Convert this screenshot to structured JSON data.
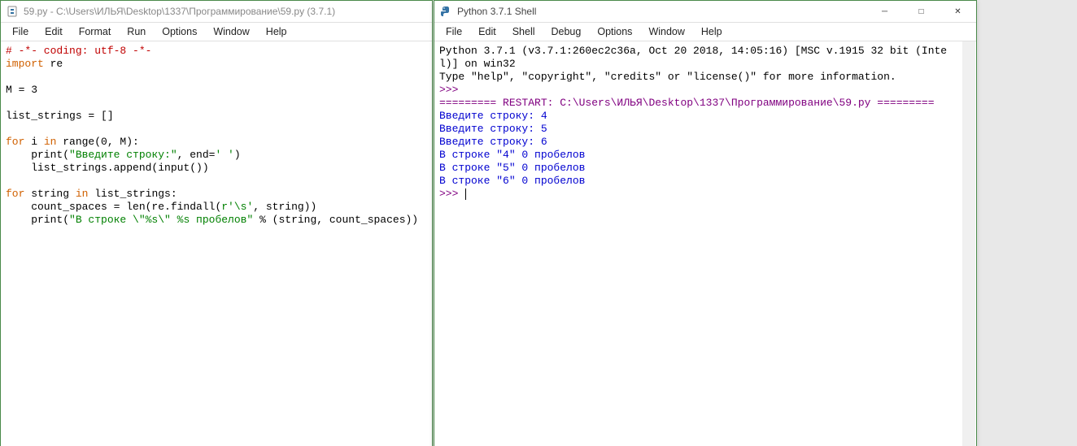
{
  "editor": {
    "title": "59.py - C:\\Users\\ИЛЬЯ\\Desktop\\1337\\Программирование\\59.py (3.7.1)",
    "menu": [
      "File",
      "Edit",
      "Format",
      "Run",
      "Options",
      "Window",
      "Help"
    ],
    "code": {
      "l1": "# -*- coding: utf-8 -*-",
      "l2a": "import",
      "l2b": " re",
      "l3": "",
      "l4": "M = 3",
      "l5": "",
      "l6": "list_strings = []",
      "l7": "",
      "l8a": "for",
      "l8b": " i ",
      "l8c": "in",
      "l8d": " range(0, M):",
      "l9a": "    print(",
      "l9b": "\"Введите строку:\"",
      "l9c": ", end=",
      "l9d": "' '",
      "l9e": ")",
      "l10": "    list_strings.append(input())",
      "l11": "",
      "l12a": "for",
      "l12b": " string ",
      "l12c": "in",
      "l12d": " list_strings:",
      "l13a": "    count_spaces = len(re.findall(",
      "l13b": "r'\\s'",
      "l13c": ", string))",
      "l14a": "    print(",
      "l14b": "\"В строке \\\"%s\\\" %s пробелов\"",
      "l14c": " % (string, count_spaces))"
    }
  },
  "shell": {
    "title": "Python 3.7.1 Shell",
    "menu": [
      "File",
      "Edit",
      "Shell",
      "Debug",
      "Options",
      "Window",
      "Help"
    ],
    "controls": {
      "min": "─",
      "max": "□",
      "close": "✕"
    },
    "out": {
      "banner1": "Python 3.7.1 (v3.7.1:260ec2c36a, Oct 20 2018, 14:05:16) [MSC v.1915 32 bit (Inte",
      "banner2": "l)] on win32",
      "banner3": "Type \"help\", \"copyright\", \"credits\" or \"license()\" for more information.",
      "prompt1": ">>> ",
      "restart": "========= RESTART: C:\\Users\\ИЛЬЯ\\Desktop\\1337\\Программирование\\59.py =========",
      "in1": "Введите строку: 4",
      "in2": "Введите строку: 5",
      "in3": "Введите строку: 6",
      "r1": "В строке \"4\" 0 пробелов",
      "r2": "В строке \"5\" 0 пробелов",
      "r3": "В строке \"6\" 0 пробелов",
      "prompt2": ">>> "
    }
  }
}
